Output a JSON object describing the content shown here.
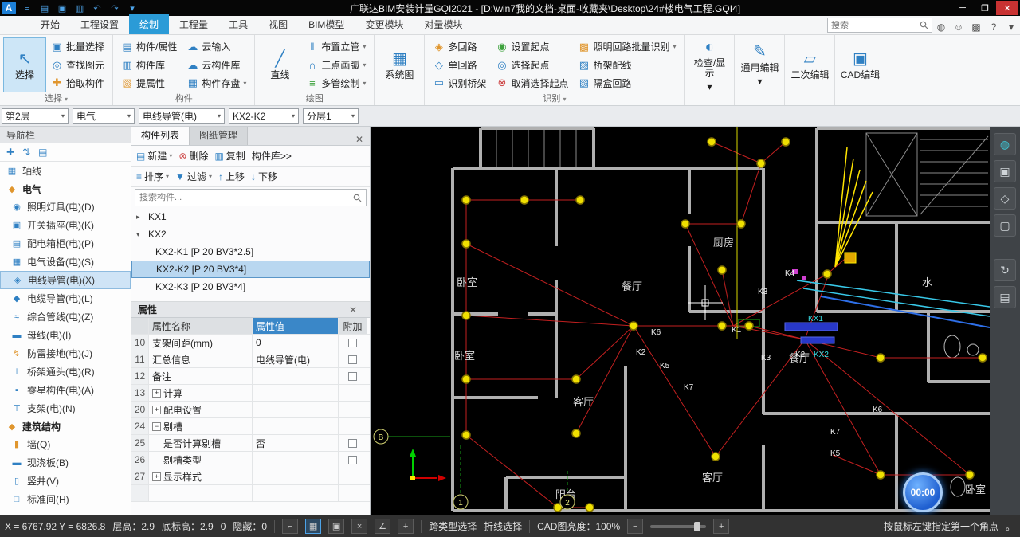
{
  "titlebar": {
    "title": "广联达BIM安装计量GQI2021 - [D:\\win7我的文档-桌面-收藏夹\\Desktop\\24#楼电气工程.GQI4]"
  },
  "tabs": [
    "开始",
    "工程设置",
    "绘制",
    "工程量",
    "工具",
    "视图",
    "BIM模型",
    "变更模块",
    "对量模块"
  ],
  "topbar": {
    "search_placeholder": "搜索"
  },
  "ribbon": {
    "select": {
      "big": "选择",
      "items": [
        "批量选择",
        "查找图元",
        "抬取构件"
      ],
      "footer": "选择"
    },
    "component": {
      "col1": [
        "构件/属性",
        "构件库",
        "提属性"
      ],
      "col2": [
        "云输入",
        "云构件库",
        "构件存盘"
      ],
      "footer": "构件"
    },
    "draw": {
      "big": "直线",
      "items": [
        "布置立管",
        "三点画弧",
        "多管绘制"
      ],
      "footer": "绘图"
    },
    "system": "系统图",
    "identify": {
      "col1": [
        "多回路",
        "单回路",
        "识别桥架"
      ],
      "col2": [
        "设置起点",
        "选择起点",
        "取消选择起点"
      ],
      "col3": [
        "照明回路批量识别",
        "桥架配线",
        "隔盒回路"
      ],
      "footer": "识别"
    },
    "bigs": [
      "检查/显示",
      "通用编辑",
      "二次编辑",
      "CAD编辑"
    ]
  },
  "filterbar": [
    "第2层",
    "电气",
    "电线导管(电)",
    "KX2-K2",
    "分层1"
  ],
  "sidebar": {
    "title": "导航栏",
    "axis": "轴线",
    "sec1": {
      "header": "电气",
      "items": [
        "照明灯具(电)(D)",
        "开关插座(电)(K)",
        "配电箱柜(电)(P)",
        "电气设备(电)(S)",
        "电线导管(电)(X)",
        "电缆导管(电)(L)",
        "综合管线(电)(Z)",
        "母线(电)(I)",
        "防雷接地(电)(J)",
        "桥架通头(电)(R)",
        "零星构件(电)(A)",
        "支架(电)(N)"
      ]
    },
    "sec2": {
      "header": "建筑结构",
      "items": [
        "墙(Q)",
        "现浇板(B)",
        "竖井(V)",
        "标准间(H)"
      ]
    }
  },
  "panel": {
    "tabs": [
      "构件列表",
      "图纸管理"
    ],
    "toolbar": [
      "新建",
      "删除",
      "复制",
      "构件库>>"
    ],
    "toolbar2": [
      "排序",
      "过滤",
      "上移",
      "下移"
    ],
    "search_placeholder": "搜索构件...",
    "tree": [
      {
        "label": "KX1"
      },
      {
        "label": "KX2"
      },
      {
        "label": "KX2-K1 [P 20 BV3*2.5]"
      },
      {
        "label": "KX2-K2 [P 20 BV3*4]"
      },
      {
        "label": "KX2-K3 [P 20 BV3*4]"
      }
    ]
  },
  "properties": {
    "title": "属性",
    "headers": [
      "属性名称",
      "属性值",
      "附加"
    ],
    "rows": [
      {
        "num": "10",
        "name": "支架间距(mm)",
        "value": "0"
      },
      {
        "num": "11",
        "name": "汇总信息",
        "value": "电线导管(电)"
      },
      {
        "num": "12",
        "name": "备注",
        "value": ""
      },
      {
        "num": "13",
        "name": "计算",
        "value": ""
      },
      {
        "num": "20",
        "name": "配电设置",
        "value": ""
      },
      {
        "num": "24",
        "name": "剔槽",
        "value": ""
      },
      {
        "num": "25",
        "name": "是否计算剔槽",
        "value": "否"
      },
      {
        "num": "26",
        "name": "剔槽类型",
        "value": ""
      },
      {
        "num": "27",
        "name": "显示样式",
        "value": ""
      }
    ]
  },
  "canvas": {
    "rooms": [
      "厨房",
      "卧室",
      "餐厅",
      "水",
      "卧室",
      "客厅",
      "餐厅",
      "客厅",
      "阳台",
      "卧室"
    ],
    "circuits": [
      "K6",
      "K2",
      "K5",
      "K7",
      "K3",
      "K4",
      "KX1",
      "K1",
      "K3",
      "K2",
      "KX2",
      "K6",
      "K7",
      "K5"
    ],
    "axes": [
      "B",
      "1",
      "2"
    ],
    "timer": "00:00"
  },
  "statusbar": {
    "coords": "X = 6767.92 Y = 6826.8",
    "floor": "层高：2.9",
    "elev": "底标高：2.9",
    "zero": "0",
    "hidden": "隐藏：0",
    "cross": "跨类型选择",
    "polyline": "折线选择",
    "brightness": "CAD图亮度：100%",
    "hint": "按鼠标左键指定第一个角点",
    "period": "。"
  }
}
